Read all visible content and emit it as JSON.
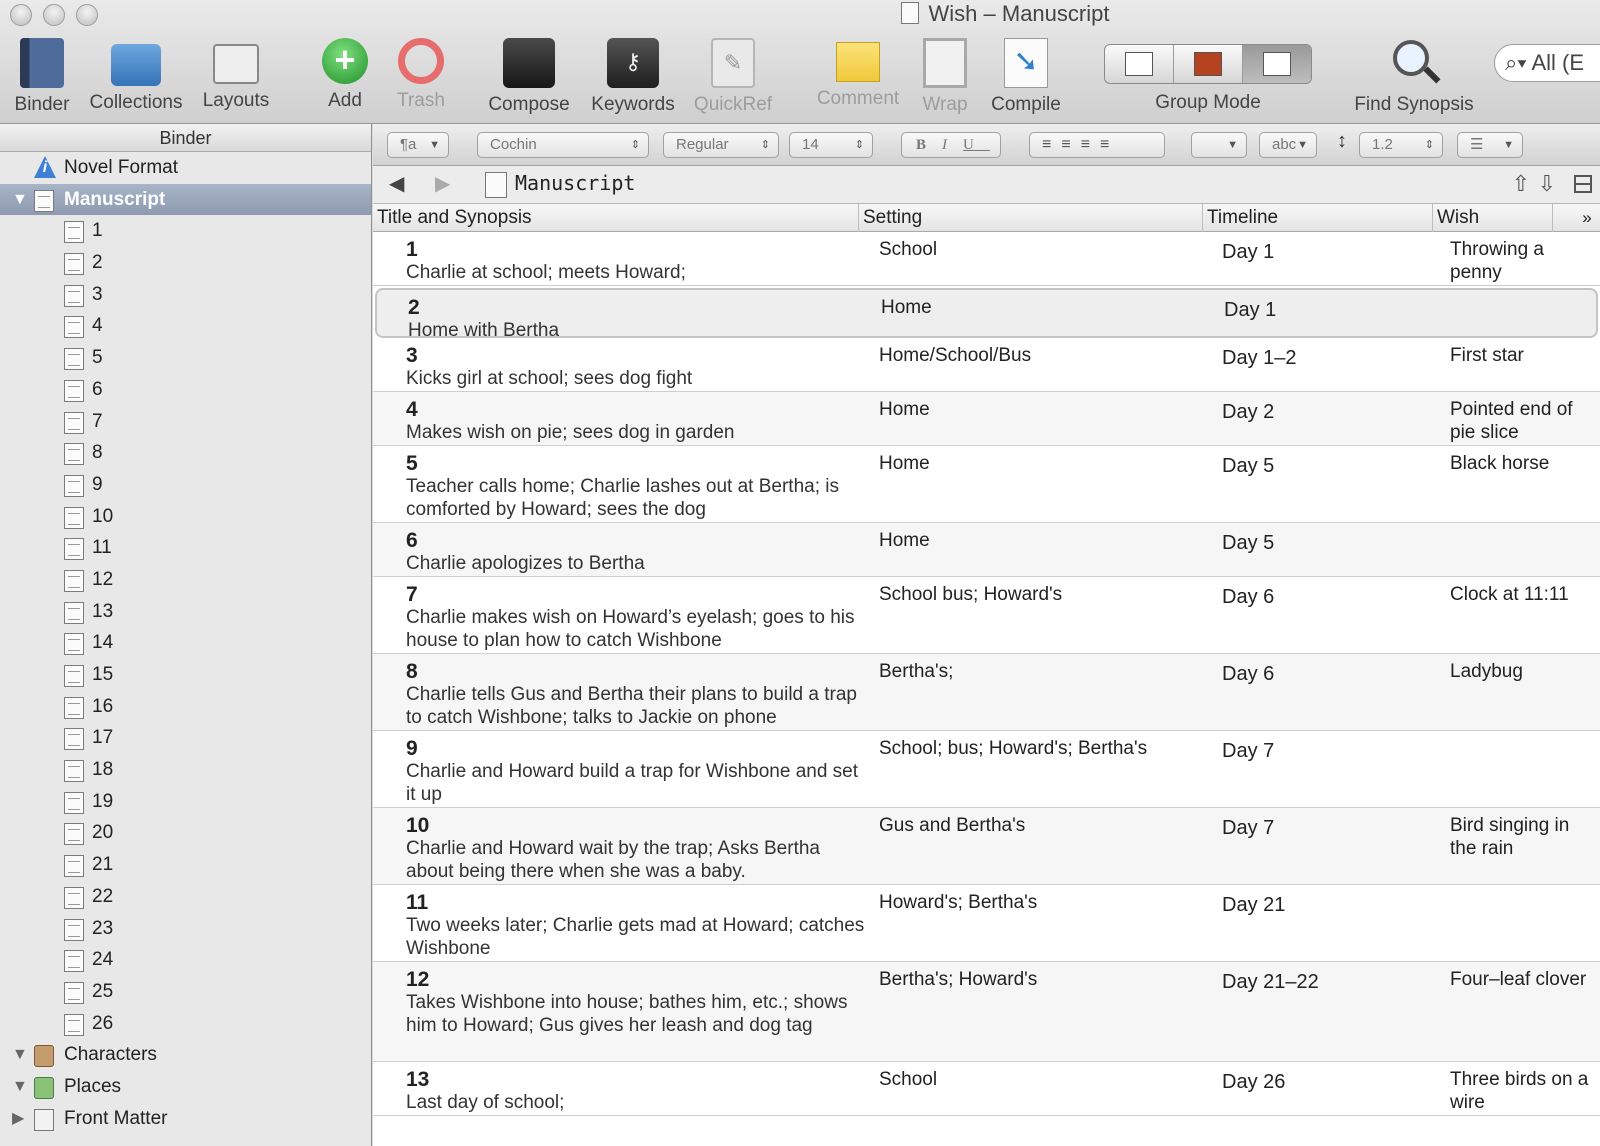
{
  "window": {
    "title": "Wish – Manuscript"
  },
  "toolbar": {
    "binder": "Binder",
    "collections": "Collections",
    "layouts": "Layouts",
    "add": "Add",
    "trash": "Trash",
    "compose": "Compose",
    "keywords": "Keywords",
    "quickref": "QuickRef",
    "comment": "Comment",
    "wrap": "Wrap",
    "compile": "Compile",
    "group_mode": "Group Mode",
    "find_synopsis": "Find Synopsis",
    "search_text": "All (E"
  },
  "sidebar": {
    "header": "Binder",
    "items": [
      {
        "label": "Novel Format",
        "icon": "info-icon"
      },
      {
        "label": "Manuscript",
        "icon": "manuscript-icon",
        "selected": true,
        "expanded": true
      },
      {
        "label": "1"
      },
      {
        "label": "2"
      },
      {
        "label": "3"
      },
      {
        "label": "4"
      },
      {
        "label": "5"
      },
      {
        "label": "6"
      },
      {
        "label": "7"
      },
      {
        "label": "8"
      },
      {
        "label": "9"
      },
      {
        "label": "10"
      },
      {
        "label": "11"
      },
      {
        "label": "12"
      },
      {
        "label": "13"
      },
      {
        "label": "14"
      },
      {
        "label": "15"
      },
      {
        "label": "16"
      },
      {
        "label": "17"
      },
      {
        "label": "18"
      },
      {
        "label": "19"
      },
      {
        "label": "20"
      },
      {
        "label": "21"
      },
      {
        "label": "22"
      },
      {
        "label": "23"
      },
      {
        "label": "24"
      },
      {
        "label": "25"
      },
      {
        "label": "26"
      },
      {
        "label": "Characters",
        "icon": "characters-folder-icon",
        "expanded": true
      },
      {
        "label": "Places",
        "icon": "places-folder-icon",
        "expanded": true
      },
      {
        "label": "Front Matter",
        "icon": "front-matter-icon",
        "expanded": false
      }
    ]
  },
  "formatbar": {
    "paragraph": "¶a",
    "font": "Cochin",
    "style": "Regular",
    "size": "14",
    "bold": "B",
    "italic": "I",
    "underline": "U",
    "highlight": "abc",
    "line_spacing": "1.2"
  },
  "editor": {
    "header_title": "Manuscript",
    "columns": [
      "Title and Synopsis",
      "Setting",
      "Timeline",
      "Wish"
    ],
    "more": "»",
    "rows": [
      {
        "num": "1",
        "synopsis": "Charlie at school; meets Howard;",
        "setting": "School",
        "timeline": "Day 1",
        "wish": "Throwing a penny"
      },
      {
        "num": "2",
        "synopsis": "Home with Bertha",
        "setting": "Home",
        "timeline": "Day 1",
        "wish": "",
        "selected": true
      },
      {
        "num": "3",
        "synopsis": "Kicks girl at school; sees dog fight",
        "setting": "Home/School/Bus",
        "timeline": "Day 1–2",
        "wish": "First star"
      },
      {
        "num": "4",
        "synopsis": "Makes wish on pie; sees dog in garden",
        "setting": "Home",
        "timeline": "Day 2",
        "wish": "Pointed end of pie slice"
      },
      {
        "num": "5",
        "synopsis": "Teacher calls home; Charlie lashes out at Bertha; is comforted by Howard; sees the dog",
        "setting": "Home",
        "timeline": "Day 5",
        "wish": "Black horse"
      },
      {
        "num": "6",
        "synopsis": "Charlie apologizes to Bertha",
        "setting": "Home",
        "timeline": "Day 5",
        "wish": ""
      },
      {
        "num": "7",
        "synopsis": "Charlie makes wish on Howard’s eyelash; goes to his house to plan how to catch Wishbone",
        "setting": "School bus; Howard's",
        "timeline": "Day 6",
        "wish": "Clock at 11:11"
      },
      {
        "num": "8",
        "synopsis": "Charlie tells Gus and Bertha their plans to build a trap to catch Wishbone; talks to Jackie on phone",
        "setting": "Bertha's;",
        "timeline": "Day 6",
        "wish": "Ladybug"
      },
      {
        "num": "9",
        "synopsis": "Charlie and Howard build a trap for Wishbone and set it up",
        "setting": "School; bus; Howard's; Bertha's",
        "timeline": "Day 7",
        "wish": ""
      },
      {
        "num": "10",
        "synopsis": "Charlie and Howard wait by the trap; Asks Bertha about being there when she was a baby.",
        "setting": "Gus and Bertha's",
        "timeline": "Day 7",
        "wish": "Bird singing in the rain"
      },
      {
        "num": "11",
        "synopsis": "Two weeks later; Charlie gets mad at Howard; catches Wishbone",
        "setting": "Howard's; Bertha's",
        "timeline": "Day 21",
        "wish": ""
      },
      {
        "num": "12",
        "synopsis": "Takes Wishbone into house; bathes him, etc.; shows him to Howard; Gus gives her leash and dog tag",
        "setting": "Bertha's; Howard's",
        "timeline": "Day 21–22",
        "wish": "Four–leaf clover"
      },
      {
        "num": "13",
        "synopsis": "Last day of school;",
        "setting": "School",
        "timeline": "Day 26",
        "wish": "Three birds on a wire"
      }
    ]
  }
}
